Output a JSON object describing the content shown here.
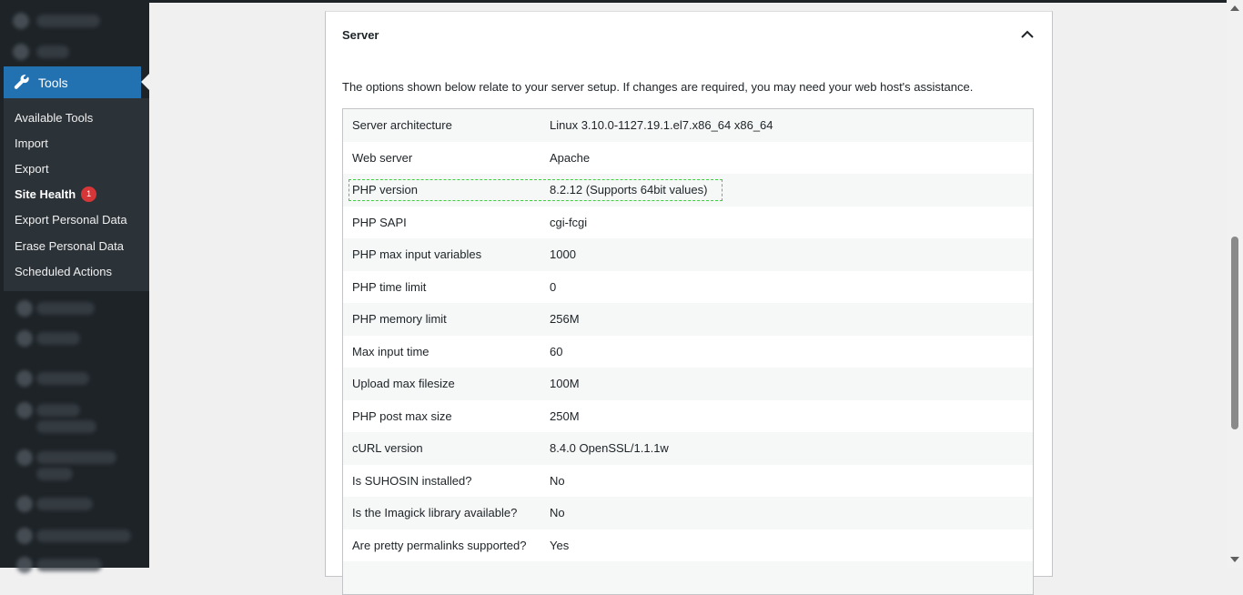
{
  "sidebar": {
    "tools_label": "Tools",
    "submenu": [
      {
        "label": "Available Tools"
      },
      {
        "label": "Import"
      },
      {
        "label": "Export"
      },
      {
        "label": "Site Health",
        "badge": "1",
        "current": true
      },
      {
        "label": "Export Personal Data"
      },
      {
        "label": "Erase Personal Data"
      },
      {
        "label": "Scheduled Actions"
      }
    ]
  },
  "panel": {
    "title": "Server",
    "description": "The options shown below relate to your server setup. If changes are required, you may need your web host's assistance.",
    "rows": [
      {
        "label": "Server architecture",
        "value": "Linux 3.10.0-1127.19.1.el7.x86_64 x86_64"
      },
      {
        "label": "Web server",
        "value": "Apache"
      },
      {
        "label": "PHP version",
        "value": "8.2.12 (Supports 64bit values)"
      },
      {
        "label": "PHP SAPI",
        "value": "cgi-fcgi"
      },
      {
        "label": "PHP max input variables",
        "value": "1000"
      },
      {
        "label": "PHP time limit",
        "value": "0"
      },
      {
        "label": "PHP memory limit",
        "value": "256M"
      },
      {
        "label": "Max input time",
        "value": "60"
      },
      {
        "label": "Upload max filesize",
        "value": "100M"
      },
      {
        "label": "PHP post max size",
        "value": "250M"
      },
      {
        "label": "cURL version",
        "value": "8.4.0 OpenSSL/1.1.1w"
      },
      {
        "label": "Is SUHOSIN installed?",
        "value": "No"
      },
      {
        "label": "Is the Imagick library available?",
        "value": "No"
      },
      {
        "label": "Are pretty permalinks supported?",
        "value": "Yes"
      },
      {
        "label": "",
        "value": ""
      }
    ]
  },
  "colors": {
    "accent": "#2271b1",
    "sidebar": "#1d2327",
    "badge": "#d63638"
  }
}
